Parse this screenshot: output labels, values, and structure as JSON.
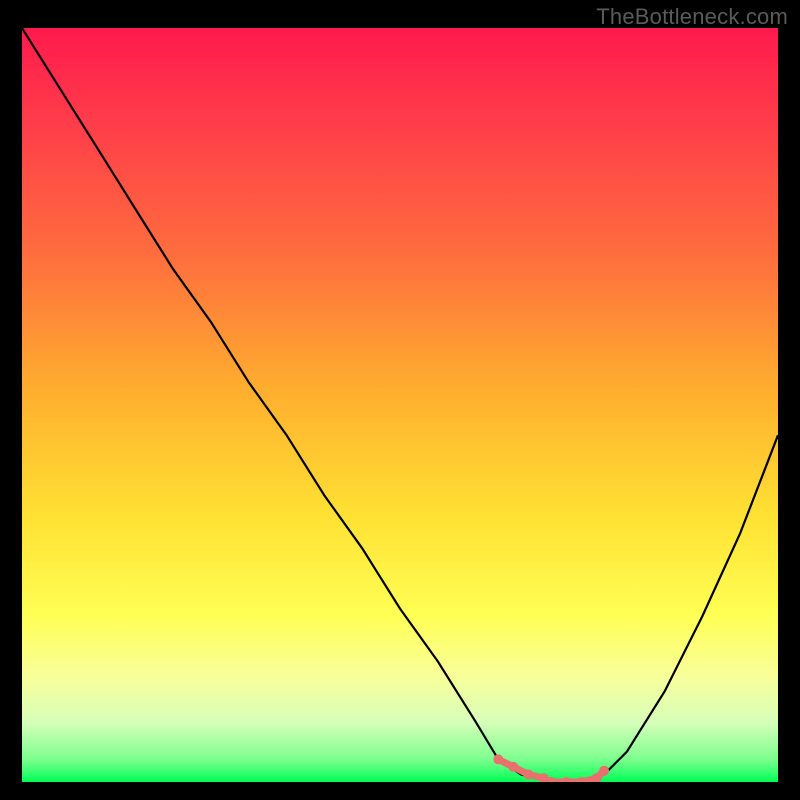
{
  "watermark": "TheBottleneck.com",
  "chart_data": {
    "type": "line",
    "title": "",
    "xlabel": "",
    "ylabel": "",
    "xlim": [
      0,
      100
    ],
    "ylim": [
      0,
      100
    ],
    "series": [
      {
        "name": "bottleneck-curve",
        "x": [
          0,
          5,
          10,
          15,
          20,
          25,
          30,
          35,
          40,
          45,
          50,
          55,
          60,
          63,
          66,
          70,
          74,
          77,
          80,
          85,
          90,
          95,
          100
        ],
        "values": [
          100,
          92,
          84,
          76,
          68,
          61,
          53,
          46,
          38,
          31,
          23,
          16,
          8,
          3,
          1,
          0,
          0,
          1,
          4,
          12,
          22,
          33,
          46
        ]
      }
    ],
    "markers": {
      "name": "min-segment",
      "x": [
        63,
        65,
        67,
        69,
        70,
        72,
        74,
        76,
        77
      ],
      "values": [
        3,
        2,
        1,
        0.5,
        0,
        0,
        0,
        0.5,
        1.5
      ],
      "color": "#e8716e"
    },
    "gradient_stops": [
      {
        "pos": 0.0,
        "color": "#ff1a4d"
      },
      {
        "pos": 0.12,
        "color": "#ff3b4a"
      },
      {
        "pos": 0.3,
        "color": "#ff6d3e"
      },
      {
        "pos": 0.48,
        "color": "#ffae2e"
      },
      {
        "pos": 0.65,
        "color": "#ffe233"
      },
      {
        "pos": 0.78,
        "color": "#ffff55"
      },
      {
        "pos": 0.86,
        "color": "#f8ff9a"
      },
      {
        "pos": 0.92,
        "color": "#d7ffb9"
      },
      {
        "pos": 0.97,
        "color": "#7dff8f"
      },
      {
        "pos": 1.0,
        "color": "#00ff55"
      }
    ]
  }
}
